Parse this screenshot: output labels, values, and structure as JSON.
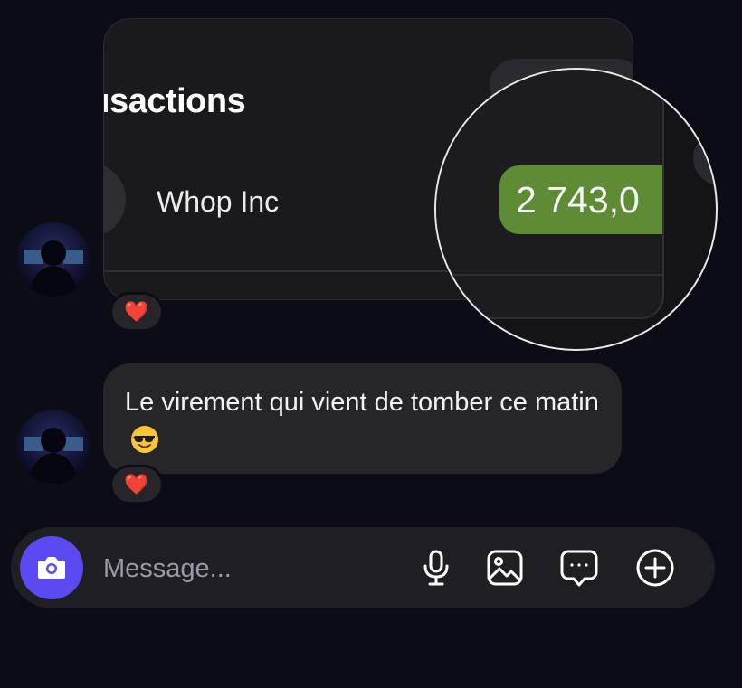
{
  "shared_image": {
    "title_fragment": "ısactions",
    "merchant": "Whop Inc",
    "amount_fragment": "2 743,0",
    "amount_color": "#5f8b35"
  },
  "messages": [
    {
      "reaction": "❤️"
    },
    {
      "text": "Le virement qui vient de tomber ce matin",
      "emoji": "sunglasses-emoji",
      "reaction": "❤️"
    }
  ],
  "composer": {
    "placeholder": "Message...",
    "icons": [
      "camera-icon",
      "microphone-icon",
      "image-icon",
      "sticker-icon",
      "plus-icon"
    ],
    "camera_color": "#5b4af2"
  }
}
